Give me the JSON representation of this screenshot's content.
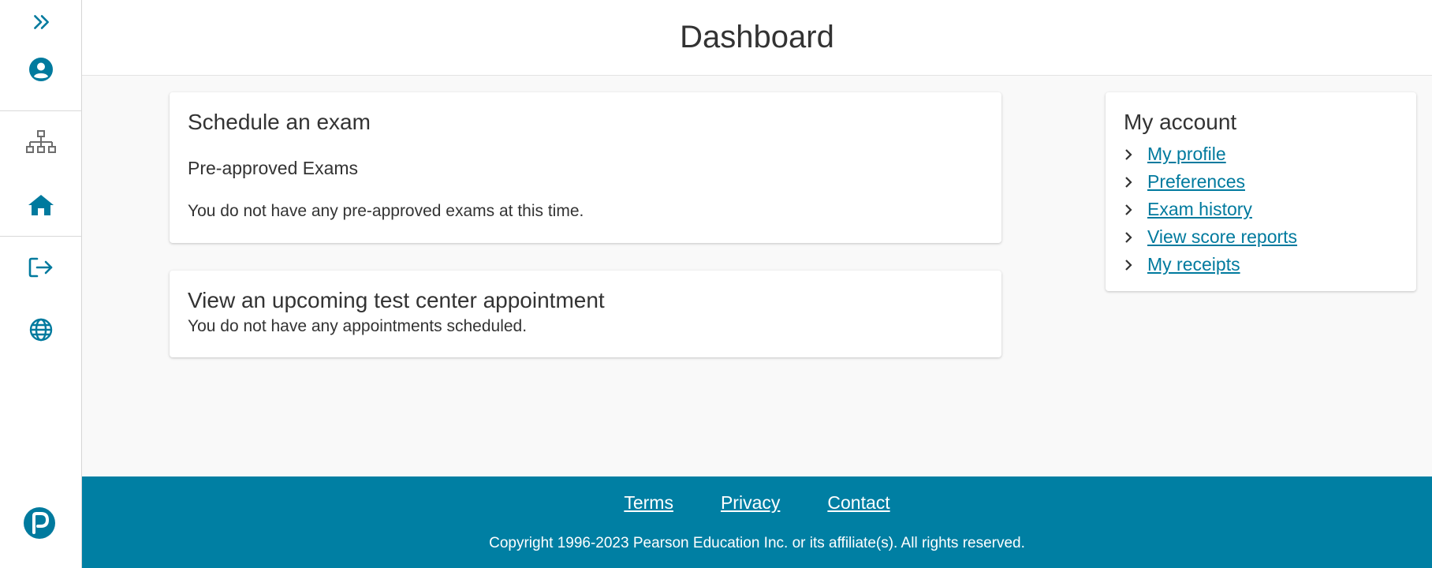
{
  "header": {
    "title": "Dashboard"
  },
  "sidebar": {
    "icons": [
      "expand-icon",
      "user-profile-icon",
      "sitemap-icon",
      "home-icon",
      "sign-out-icon",
      "globe-icon",
      "pearson-logo"
    ],
    "accent_color": "#007a9e"
  },
  "schedule_card": {
    "title": "Schedule an exam",
    "subtitle": "Pre-approved Exams",
    "message": "You do not have any pre-approved exams at this time."
  },
  "appointment_card": {
    "title": "View an upcoming test center appointment",
    "message": "You do not have any appointments scheduled."
  },
  "account": {
    "title": "My account",
    "links": [
      {
        "label": "My profile"
      },
      {
        "label": "Preferences"
      },
      {
        "label": "Exam history"
      },
      {
        "label": "View score reports"
      },
      {
        "label": "My receipts"
      }
    ]
  },
  "footer": {
    "links": [
      {
        "label": "Terms"
      },
      {
        "label": "Privacy"
      },
      {
        "label": "Contact"
      }
    ],
    "copyright": "Copyright 1996-2023 Pearson Education Inc. or its affiliate(s). All rights reserved.",
    "background_color": "#007fa3"
  }
}
